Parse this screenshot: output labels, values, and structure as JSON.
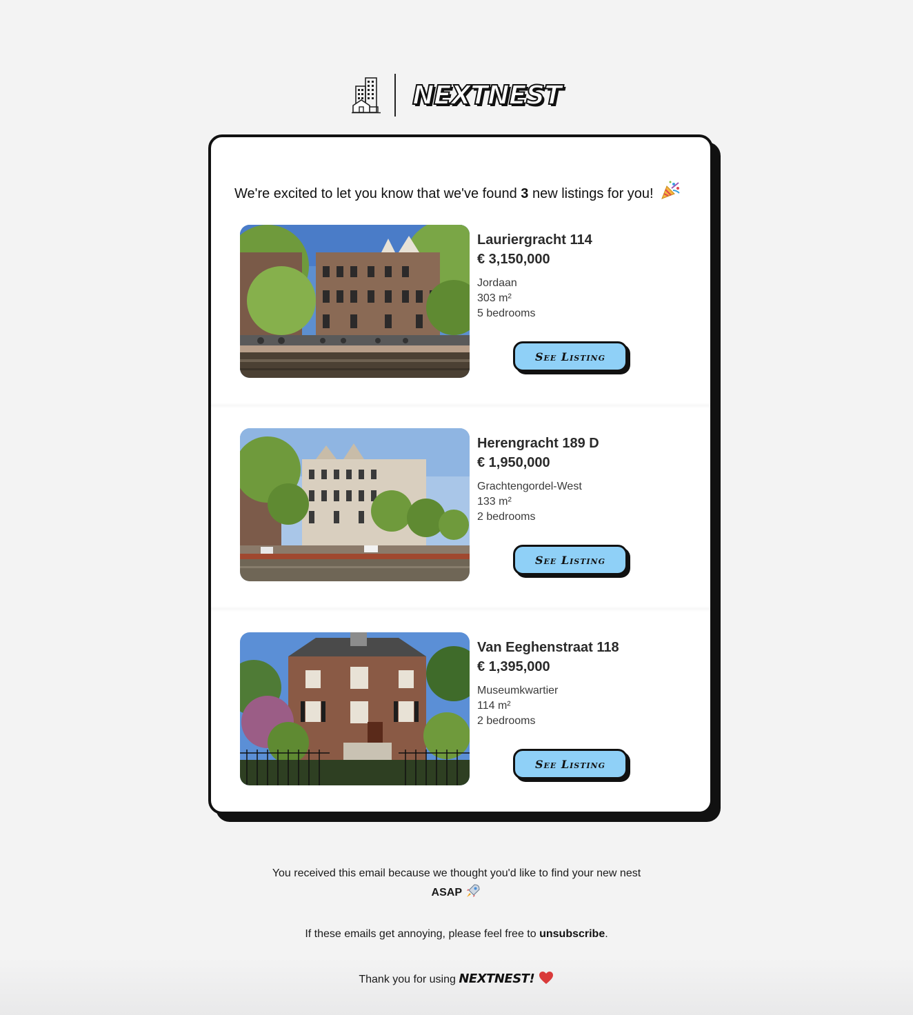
{
  "brand": {
    "name": "NEXTNEST"
  },
  "intro": {
    "prefix": "We're excited to let you know that we've found",
    "count": "3",
    "suffix": "new listings for you!"
  },
  "listings": [
    {
      "address": "Lauriergracht 114",
      "price": "€ 3,150,000",
      "neighborhood": "Jordaan",
      "area": "303 m²",
      "bedrooms": "5 bedrooms",
      "button_label": "See Listing"
    },
    {
      "address": "Herengracht 189 D",
      "price": "€ 1,950,000",
      "neighborhood": "Grachtengordel-West",
      "area": "133 m²",
      "bedrooms": "2 bedrooms",
      "button_label": "See Listing"
    },
    {
      "address": "Van Eeghenstraat 118",
      "price": "€ 1,395,000",
      "neighborhood": "Museumkwartier",
      "area": "114 m²",
      "bedrooms": "2 bedrooms",
      "button_label": "See Listing"
    }
  ],
  "footer": {
    "received_text": "You received this email because we thought you'd like to find your new nest",
    "asap": "ASAP",
    "annoying_prefix": "If these emails get annoying, please feel free to",
    "unsubscribe_label": "unsubscribe",
    "annoying_suffix": ".",
    "thanks_prefix": "Thank you for using",
    "thanks_brand": "NEXTNEST!"
  },
  "colors": {
    "button": "#8fd0f7",
    "background": "#f3f3f3",
    "card": "#ffffff",
    "outline": "#111111"
  },
  "icons": [
    "building-icon",
    "party-popper-icon",
    "rocket-icon",
    "heart-icon"
  ]
}
